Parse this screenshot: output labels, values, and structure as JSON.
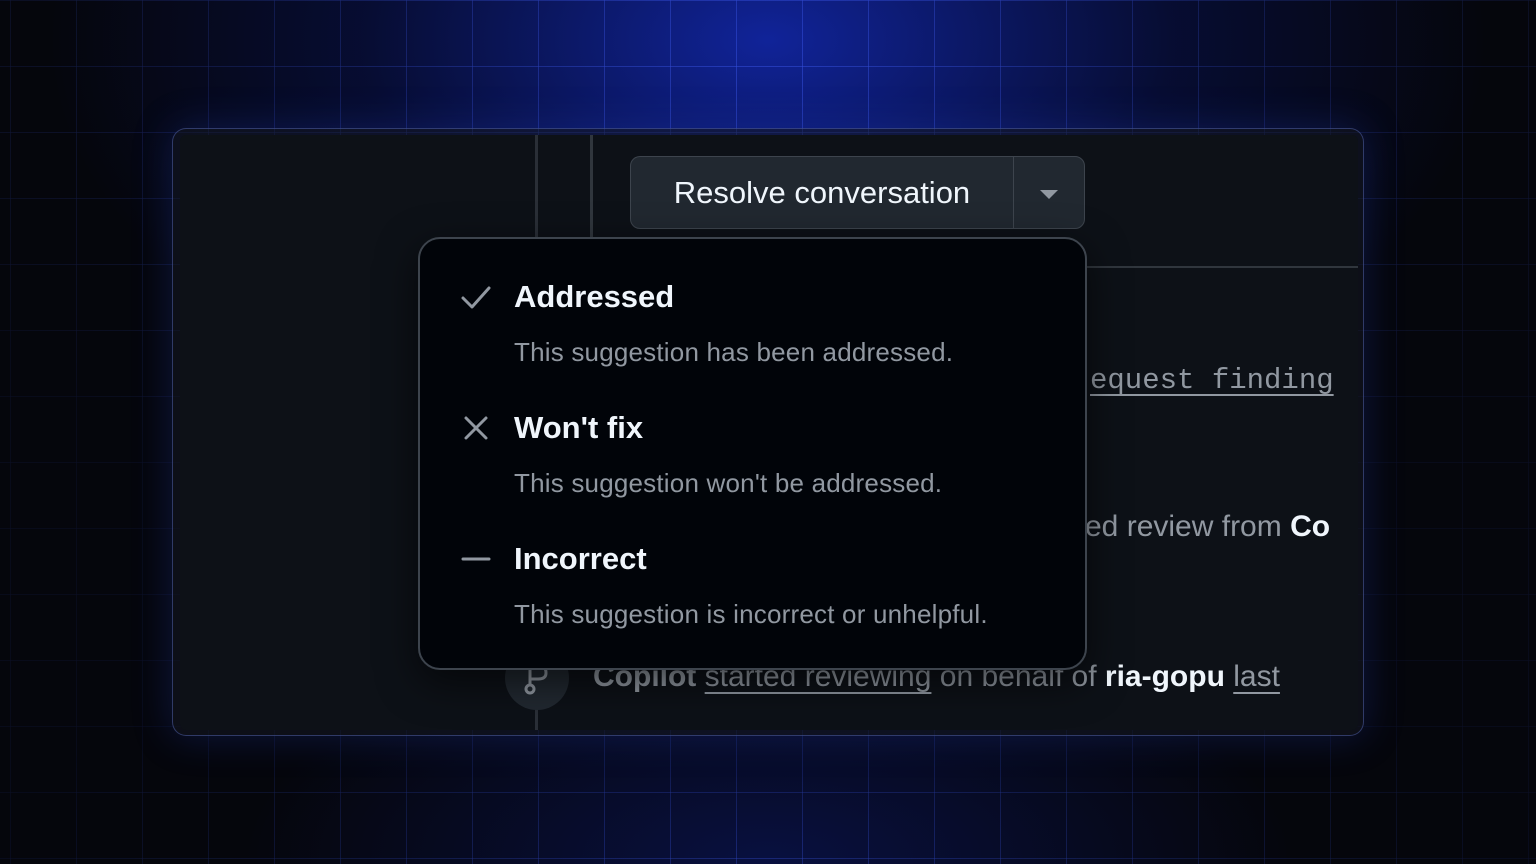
{
  "resolve_button": {
    "label": "Resolve conversation",
    "caret_icon": "triangle-down-icon"
  },
  "timeline": {
    "line1_fragment": "equest finding",
    "line2_fragment": "ed review from ",
    "line2_strong": "Co",
    "line3": {
      "actor": "Copilot",
      "action": "started reviewing",
      "middle": " on behalf of ",
      "user": "ria-gopu",
      "tail": "last"
    },
    "badge_icon": "git-pull-request-icon"
  },
  "menu": {
    "items": [
      {
        "icon": "check-icon",
        "title": "Addressed",
        "description": "This suggestion has been addressed."
      },
      {
        "icon": "x-icon",
        "title": "Won't fix",
        "description": "This suggestion won't be addressed."
      },
      {
        "icon": "dash-icon",
        "title": "Incorrect",
        "description": "This suggestion is incorrect or unhelpful."
      }
    ]
  },
  "colors": {
    "panel_bg": "#0d1117",
    "menu_bg": "#010409",
    "text_primary": "#f0f6fc",
    "text_muted": "#9198a1",
    "border": "#3d444d",
    "grid_glow": "#2a46ff"
  }
}
